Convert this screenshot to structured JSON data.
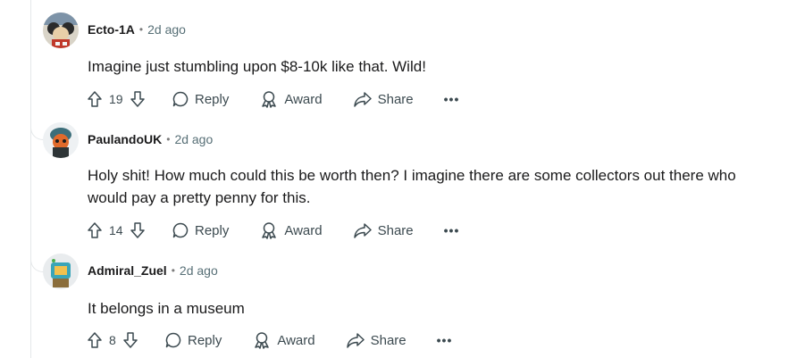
{
  "comments": [
    {
      "author": "Ecto-1A",
      "time": "2d ago",
      "body": "Imagine just stumbling upon $8-10k like that. Wild!",
      "votes": "19",
      "reply_label": "Reply",
      "award_label": "Award",
      "share_label": "Share",
      "more_label": "•••"
    },
    {
      "author": "PaulandoUK",
      "time": "2d ago",
      "body_line1": "Holy shit! How much could this be worth then? I imagine there are some collectors out there who",
      "body_line2": "would pay a pretty penny for this.",
      "votes": "14",
      "reply_label": "Reply",
      "award_label": "Award",
      "share_label": "Share",
      "more_label": "•••"
    },
    {
      "author": "Admiral_Zuel",
      "time": "2d ago",
      "body": "It belongs in a museum",
      "votes": "8",
      "reply_label": "Reply",
      "award_label": "Award",
      "share_label": "Share",
      "more_label": "•••"
    }
  ],
  "separator": "•",
  "icons": {
    "upvote": "upvote-arrow-icon",
    "downvote": "downvote-arrow-icon",
    "reply": "speech-bubble-icon",
    "award": "award-ribbon-icon",
    "share": "share-arrow-icon",
    "more": "more-options-icon"
  },
  "colors": {
    "text": "#1a1a1b",
    "muted": "#576f76",
    "action": "#3c4a50",
    "line": "#e5e8ea"
  }
}
